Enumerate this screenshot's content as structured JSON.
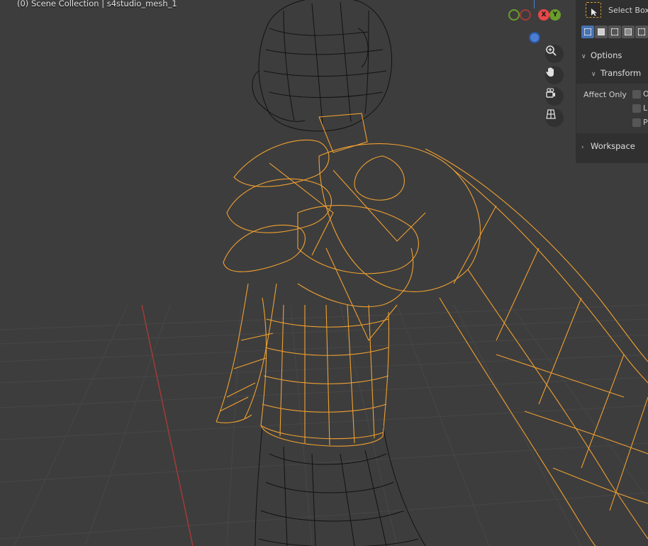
{
  "viewport": {
    "scene_label": "(0) Scene Collection | s4studio_mesh_1"
  },
  "gizmo": {
    "x_label": "X",
    "y_label": "Y",
    "colors": {
      "x": "#e8474a",
      "y": "#6a9c2b",
      "z": "#4a7dd3"
    }
  },
  "nav": {
    "zoom": "zoom-icon",
    "pan": "hand-icon",
    "camera": "camera-icon",
    "ortho": "grid-icon"
  },
  "sidebar": {
    "tool_label": "Select Box",
    "options_header": "Options",
    "transform_header": "Transform",
    "affect_only_label": "Affect Only",
    "affect_items": [
      "O",
      "L",
      "P"
    ],
    "workspace_header": "Workspace"
  },
  "colors": {
    "background": "#3d3d3d",
    "selected_wire": "#f0a030",
    "unselected_wire": "#111111",
    "accent": "#4772b3"
  }
}
